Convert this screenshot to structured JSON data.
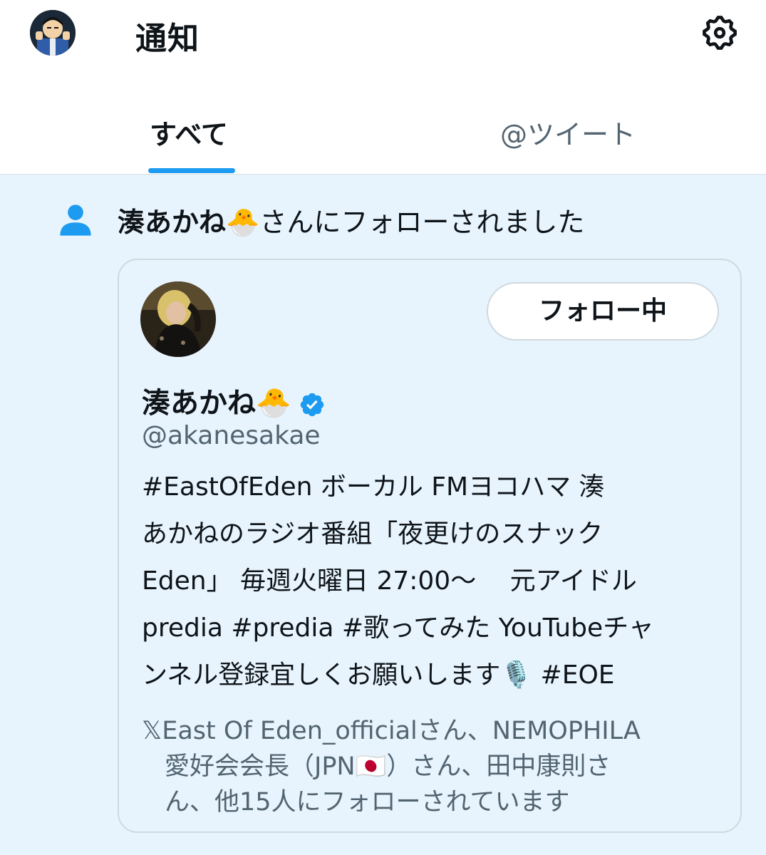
{
  "header": {
    "title": "通知",
    "settings_icon": "gear-icon"
  },
  "tabs": [
    {
      "label": "すべて",
      "active": true
    },
    {
      "label": "@ツイート",
      "active": false
    }
  ],
  "notification": {
    "icon": "person-icon",
    "actor_name": "湊あかね🐣",
    "action_text": "さんにフォローされました",
    "card": {
      "follow_button_label": "フォロー中",
      "display_name": "湊あかね🐣",
      "verified": true,
      "handle": "@akanesakae",
      "bio_lines": [
        "#EastOfEden ボーカル FMヨコハマ 湊",
        "あかねのラジオ番組「夜更けのスナック",
        "Eden」 毎週火曜日 27:00〜　 元アイドル",
        "predia #predia #歌ってみた YouTubeチャ",
        "ンネル登録宜しくお願いします🎙️ #EOE"
      ],
      "followed_by_lines": [
        "𝕏East Of Eden_officialさん、NEMOPHILA",
        "愛好会会長（JPN🇯🇵）さん、田中康則さ",
        "ん、他15人にフォローされています"
      ]
    }
  },
  "colors": {
    "accent": "#1d9bf0",
    "notification_bg": "#e7f4fd",
    "secondary_text": "#536471"
  }
}
